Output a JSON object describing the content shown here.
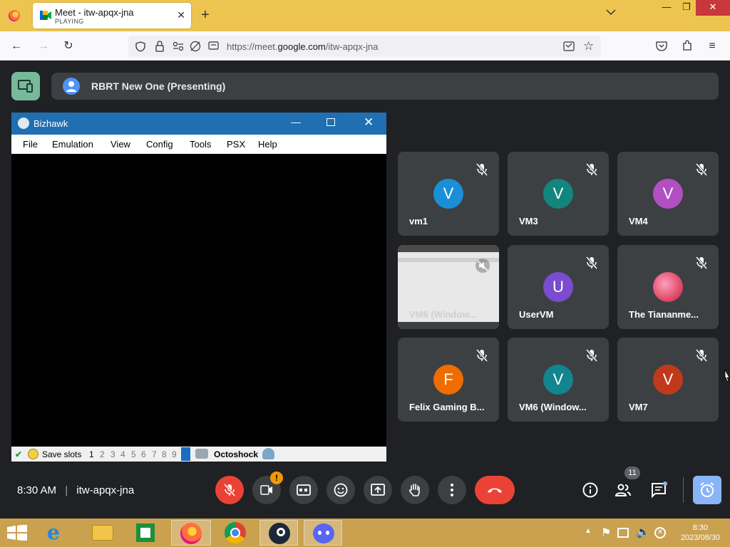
{
  "browser": {
    "tab": {
      "title": "Meet - itw-apqx-jna",
      "status": "PLAYING"
    },
    "url_prefix": "https://meet.",
    "url_domain": "google.com",
    "url_path": "/itw-apqx-jna"
  },
  "meet": {
    "presenter": "RBRT New One (Presenting)",
    "time": "8:30 AM",
    "meeting_code": "itw-apqx-jna",
    "people_count": "11",
    "participants": [
      {
        "name": "vm1",
        "initial": "V",
        "color": "#1a8fd8"
      },
      {
        "name": "VM3",
        "initial": "V",
        "color": "#12857d"
      },
      {
        "name": "VM4",
        "initial": "V",
        "color": "#b24fc3"
      },
      {
        "name": "VM6 (Window...",
        "initial": "",
        "color": ""
      },
      {
        "name": "UserVM",
        "initial": "U",
        "color": "#7a4ccf"
      },
      {
        "name": "The Tiananme...",
        "initial": "",
        "color": "#e4546e"
      },
      {
        "name": "Felix Gaming B...",
        "initial": "F",
        "color": "#ef6c00"
      },
      {
        "name": "VM6 (Window...",
        "initial": "V",
        "color": "#12858e"
      },
      {
        "name": "VM7",
        "initial": "V",
        "color": "#c0391a"
      }
    ]
  },
  "bizhawk": {
    "title": "Bizhawk",
    "menu": [
      "File",
      "Emulation",
      "View",
      "Config",
      "Tools",
      "PSX",
      "Help"
    ],
    "save_slots_label": "Save slots",
    "slots": [
      "1",
      "2",
      "3",
      "4",
      "5",
      "6",
      "7",
      "8",
      "9"
    ],
    "core": "Octoshock"
  },
  "taskbar": {
    "time": "8:30",
    "date": "2023/08/30"
  }
}
